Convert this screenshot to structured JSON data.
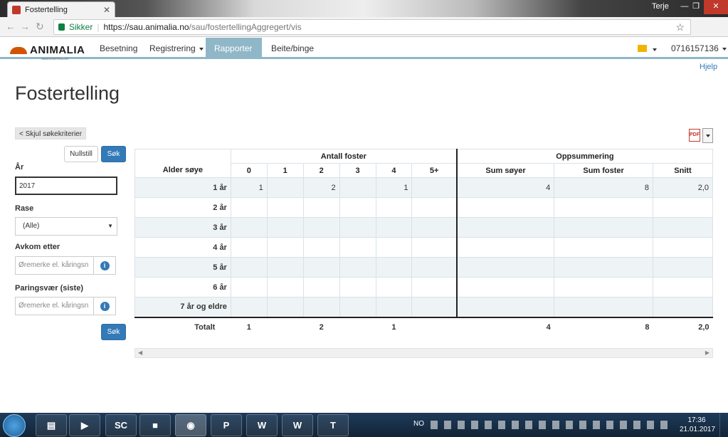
{
  "browser": {
    "tab_title": "Fostertelling",
    "user_name": "Terje",
    "secure_label": "Sikker",
    "url_host": "https://sau.animalia.no",
    "url_path": "/sau/fostertellingAggregert/vis"
  },
  "navbar": {
    "logo_text": "ANIMALIA",
    "logo_sub": "SAUEKONTROLLEN",
    "items": [
      {
        "label": "Besetning"
      },
      {
        "label": "Registrering"
      },
      {
        "label": "Rapporter"
      },
      {
        "label": "Beite/binge"
      }
    ],
    "account": "0716157136",
    "help": "Hjelp"
  },
  "page": {
    "title": "Fostertelling"
  },
  "sidebar": {
    "hide_criteria": "< Skjul søkekriterier",
    "reset_label": "Nullstill",
    "search_label": "Søk",
    "year_label": "År",
    "year_value": "2017",
    "breed_label": "Rase",
    "breed_value": "(Alle)",
    "offspring_label": "Avkom etter",
    "offspring_placeholder": "Øremerke el. kåringsn",
    "ram_label": "Paringsvær (siste)",
    "ram_placeholder": "Øremerke el. kåringsn",
    "search_bottom_label": "Søk"
  },
  "table": {
    "group_fetus": "Antall foster",
    "group_summary": "Oppsummering",
    "corner": "Alder søye",
    "fetus_cols": [
      "0",
      "1",
      "2",
      "3",
      "4",
      "5+"
    ],
    "summary_cols": [
      "Sum søyer",
      "Sum foster",
      "Snitt"
    ],
    "rows": [
      {
        "label": "1 år",
        "cells": [
          "1",
          "",
          "2",
          "",
          "1",
          "",
          "4",
          "8",
          "2,0"
        ]
      },
      {
        "label": "2 år",
        "cells": [
          "",
          "",
          "",
          "",
          "",
          "",
          "",
          "",
          ""
        ]
      },
      {
        "label": "3 år",
        "cells": [
          "",
          "",
          "",
          "",
          "",
          "",
          "",
          "",
          ""
        ]
      },
      {
        "label": "4 år",
        "cells": [
          "",
          "",
          "",
          "",
          "",
          "",
          "",
          "",
          ""
        ]
      },
      {
        "label": "5 år",
        "cells": [
          "",
          "",
          "",
          "",
          "",
          "",
          "",
          "",
          ""
        ]
      },
      {
        "label": "6 år",
        "cells": [
          "",
          "",
          "",
          "",
          "",
          "",
          "",
          "",
          ""
        ]
      },
      {
        "label": "7 år og eldre",
        "cells": [
          "",
          "",
          "",
          "",
          "",
          "",
          "",
          "",
          ""
        ]
      }
    ],
    "total": {
      "label": "Totalt",
      "cells": [
        "1",
        "",
        "2",
        "",
        "1",
        "",
        "4",
        "8",
        "2,0"
      ]
    }
  },
  "taskbar": {
    "apps": [
      "SC",
      "P",
      "W",
      "T"
    ],
    "lang": "NO",
    "time": "17:36",
    "date": "21.01.2017"
  },
  "colors": {
    "accent": "#8fb7c8",
    "primary": "#337ab7",
    "brand": "#d35400"
  },
  "icons": [
    "lock-icon",
    "star-icon",
    "folder-icon",
    "info-icon",
    "pdf-icon",
    "windows-start-icon",
    "chrome-icon"
  ]
}
